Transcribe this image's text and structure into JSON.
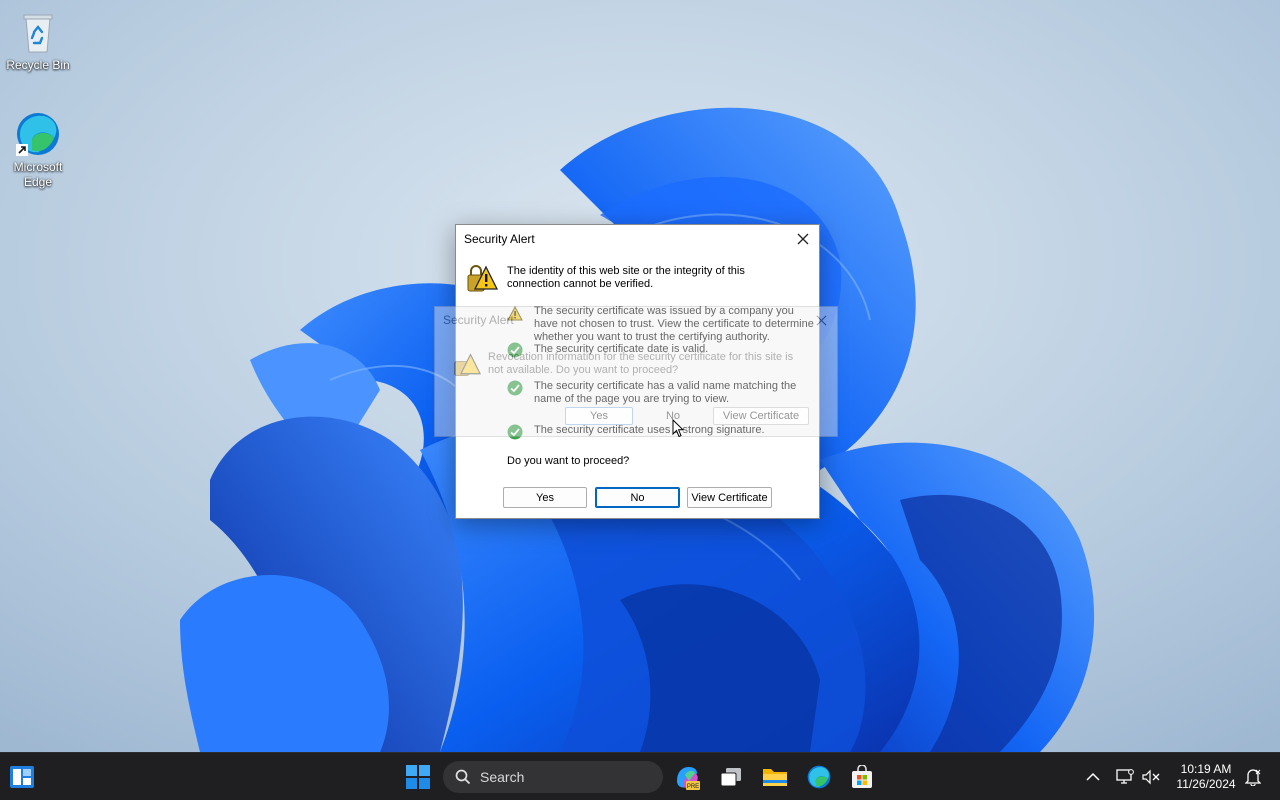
{
  "desktop": {
    "icons": [
      {
        "label": "Recycle Bin",
        "icon": "recycle-bin-icon"
      },
      {
        "label": "Microsoft Edge",
        "icon": "edge-icon"
      }
    ]
  },
  "dialog": {
    "title": "Security Alert",
    "headline": "The identity of this web site or the integrity of this connection cannot be verified.",
    "items": [
      {
        "icon": "warning-icon",
        "text": "The security certificate was issued by a company you have not chosen to trust. View the certificate to determine whether you want to trust the certifying authority."
      },
      {
        "icon": "check-icon",
        "text": "The security certificate date is valid."
      },
      {
        "icon": "check-icon",
        "text": "The security certificate has a valid name matching the name of the page you are trying to view."
      },
      {
        "icon": "check-icon",
        "text": "The security certificate uses a strong signature."
      }
    ],
    "question": "Do you want to proceed?",
    "buttons": {
      "yes": "Yes",
      "no": "No",
      "view": "View Certificate"
    }
  },
  "ghost_dialog": {
    "title": "Security Alert",
    "message": "Revocation information for the security certificate for this site is not available. Do you want to proceed?",
    "buttons": {
      "yes": "Yes",
      "no": "No",
      "view": "View Certificate"
    }
  },
  "taskbar": {
    "search_placeholder": "Search",
    "apps": [
      "widgets-icon",
      "start-icon",
      "search-icon",
      "copilot-icon",
      "task-view-icon",
      "file-explorer-icon",
      "edge-icon",
      "store-icon"
    ],
    "tray": [
      "chevron-up-icon",
      "network-icon",
      "volume-muted-icon",
      "notification-icon"
    ],
    "time": "10:19 AM",
    "date": "11/26/2024"
  },
  "colors": {
    "accent": "#0067c0",
    "taskbar": "#1f1f21",
    "warning": "#f5c518",
    "success": "#3aa34a"
  }
}
